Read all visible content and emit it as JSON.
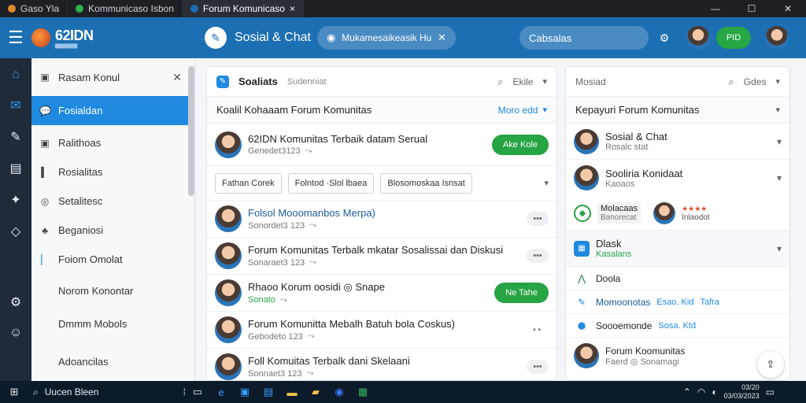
{
  "tabs": [
    {
      "label": "Gaso Yla",
      "color": "#e0892b"
    },
    {
      "label": "Kommunicaso Isbon",
      "color": "#2db34a"
    },
    {
      "label": "Forum Komunicaso",
      "color": "#1c6fb3"
    }
  ],
  "tab_close": "×",
  "window_controls": [
    "—",
    "☐",
    "✕"
  ],
  "header": {
    "brand": "62IDN",
    "brand_sub": "████████",
    "app_title": "Sosial & Chat",
    "channel_pill": "Mukamesaikeasik Huga",
    "search_label": "Cabsalas",
    "user_badge": "PID"
  },
  "left_panel": {
    "title": "Rasam Konul",
    "close": "✕",
    "items": [
      {
        "label": "Fosialdan",
        "icon": "💬",
        "selected": true
      },
      {
        "label": "Ralithoas",
        "icon": "▣"
      },
      {
        "label": "Rosialitas",
        "icon": "▍"
      },
      {
        "label": "Setalitesc",
        "icon": "◎"
      },
      {
        "label": "Beganiosi",
        "icon": "♣"
      },
      {
        "label": "Foiom Omolat",
        "icon": "▏"
      },
      {
        "label": "Norom Konontar",
        "icon": ""
      },
      {
        "label": "Dmmm Mobols",
        "icon": ""
      },
      {
        "label": "Adoancilas",
        "icon": ""
      }
    ]
  },
  "main": {
    "title": "Soaliats",
    "subtitle": "Sudenniat",
    "filter_label": "Ekile",
    "section_title": "Koalil Kohaaam Forum Komunitas",
    "section_action": "Moro edd",
    "pinned": {
      "title": "62IDN Komunitas Terbaik datam Serual",
      "meta": "Genedet3123",
      "button": "Ake Kole"
    },
    "filters": [
      "Fathan Corek",
      "Folntod ·Slol lbaea",
      "Blosomoskaa Isnsat"
    ],
    "rows": [
      {
        "title": "Folsol Mooomanbos Merpa)",
        "meta": "Sonordet3 123",
        "blue": true,
        "action": "dots"
      },
      {
        "title": "Forum Komunitas Terbalk mkatar Sosalissai dan Diskusi",
        "meta": "Sonaraet3 123",
        "action": "dots"
      },
      {
        "title": "Rhaoo Korum oosidi ◎ Snape",
        "meta": "Sonato",
        "action": "green",
        "button": "Ne Tahe"
      },
      {
        "title": "Forum Komunitta Mebalh Batuh bola Coskus)",
        "meta": "Gebodeto 123",
        "action": "small"
      },
      {
        "title": "Foll Komuitas Terbalk dani Skelaani",
        "meta": "Sonnaet3 123",
        "action": "dots"
      }
    ]
  },
  "right": {
    "search_label": "Mosiad",
    "filter": "Gdes",
    "section_title": "Kepayuri Forum Komunitas",
    "items": [
      {
        "title": "Sosial & Chat",
        "meta": "Rosalc stat"
      },
      {
        "title": "Sooliria Konidaat",
        "meta": "Kaoaos"
      }
    ],
    "mini": {
      "name": "Molacaas",
      "meta": "Banorecat",
      "rating": "★★★★",
      "rating_label": "Inlaodot"
    },
    "card": {
      "title": "Dlask",
      "sub": "Kasalans"
    },
    "list": [
      {
        "title": "Doola",
        "tag1": "",
        "tag2": ""
      },
      {
        "title": "Momoonotas",
        "tag1": "Esao.  Kid",
        "tag2": "Tafra"
      },
      {
        "title": "Soooemonde",
        "tag1": "Sosa.  Ktd",
        "tag2": ""
      }
    ],
    "footer": {
      "title": "Forum Koomunitas",
      "meta": "Faerd  ◎ Sonamagi"
    }
  },
  "taskbar": {
    "search": "Uucen Bleen",
    "clock": "03/20",
    "date": "03/03/2023"
  },
  "colors": {
    "header": "#1c6fb3",
    "rail": "#1f2b39",
    "selected": "#1f8ae0",
    "green": "#27a443"
  }
}
